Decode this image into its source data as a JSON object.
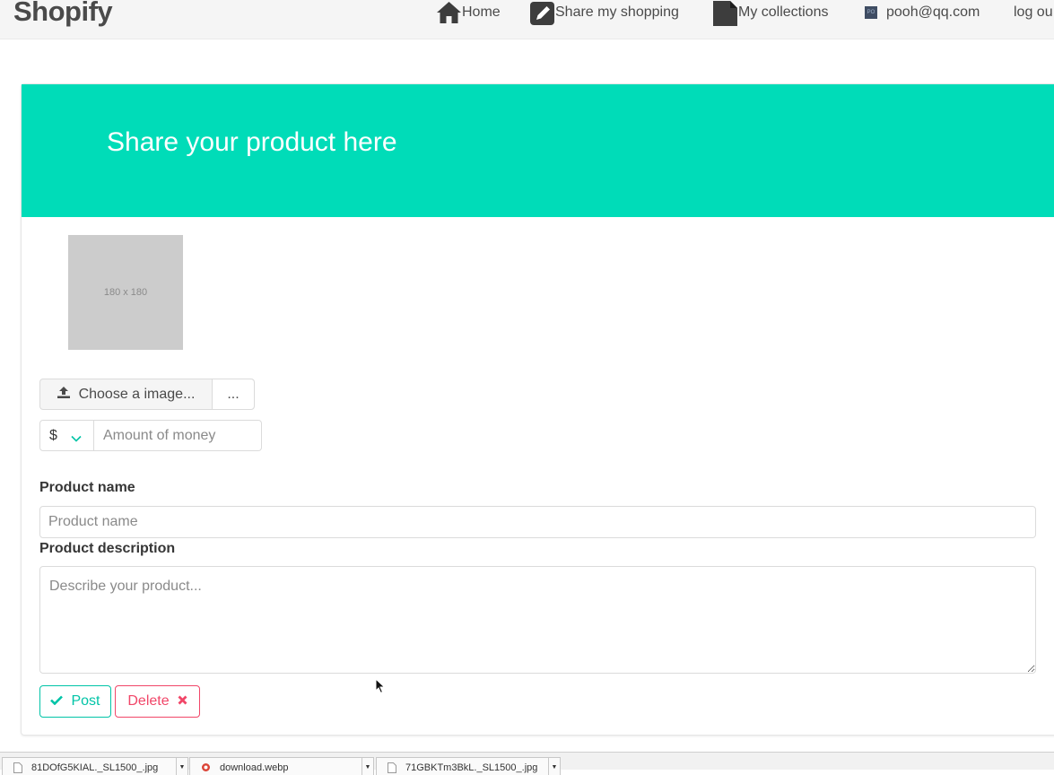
{
  "navbar": {
    "brand": "Shopify",
    "home_label": "Home",
    "share_label": "Share my shopping",
    "collections_label": "My collections",
    "user_email": "pooh@qq.com",
    "avatar_initials": "PO",
    "logout_label": "log ou"
  },
  "hero": {
    "title": "Share your product here",
    "color": "#00dcb8"
  },
  "image_placeholder": {
    "text": "180 x 180"
  },
  "file_upload": {
    "button_label": "Choose a image...",
    "filename": "..."
  },
  "price": {
    "currency": "$",
    "amount_placeholder": "Amount of money"
  },
  "form": {
    "name_label": "Product name",
    "name_placeholder": "Product name",
    "description_label": "Product description",
    "description_placeholder": "Describe your product..."
  },
  "actions": {
    "post_label": "Post",
    "delete_label": "Delete",
    "post_color": "#00c4a7",
    "delete_color": "#f14668"
  },
  "downloads": {
    "items": [
      {
        "filename": "81DOfG5KIAL._SL1500_.jpg"
      },
      {
        "filename": "download.webp"
      },
      {
        "filename": "71GBKTm3BkL._SL1500_.jpg"
      }
    ]
  },
  "icons": {
    "home": "home-icon",
    "share": "edit-icon",
    "collections": "file-icon",
    "upload": "upload-icon",
    "chevron": "chevron-down-icon",
    "check": "check-icon",
    "times": "times-icon"
  }
}
